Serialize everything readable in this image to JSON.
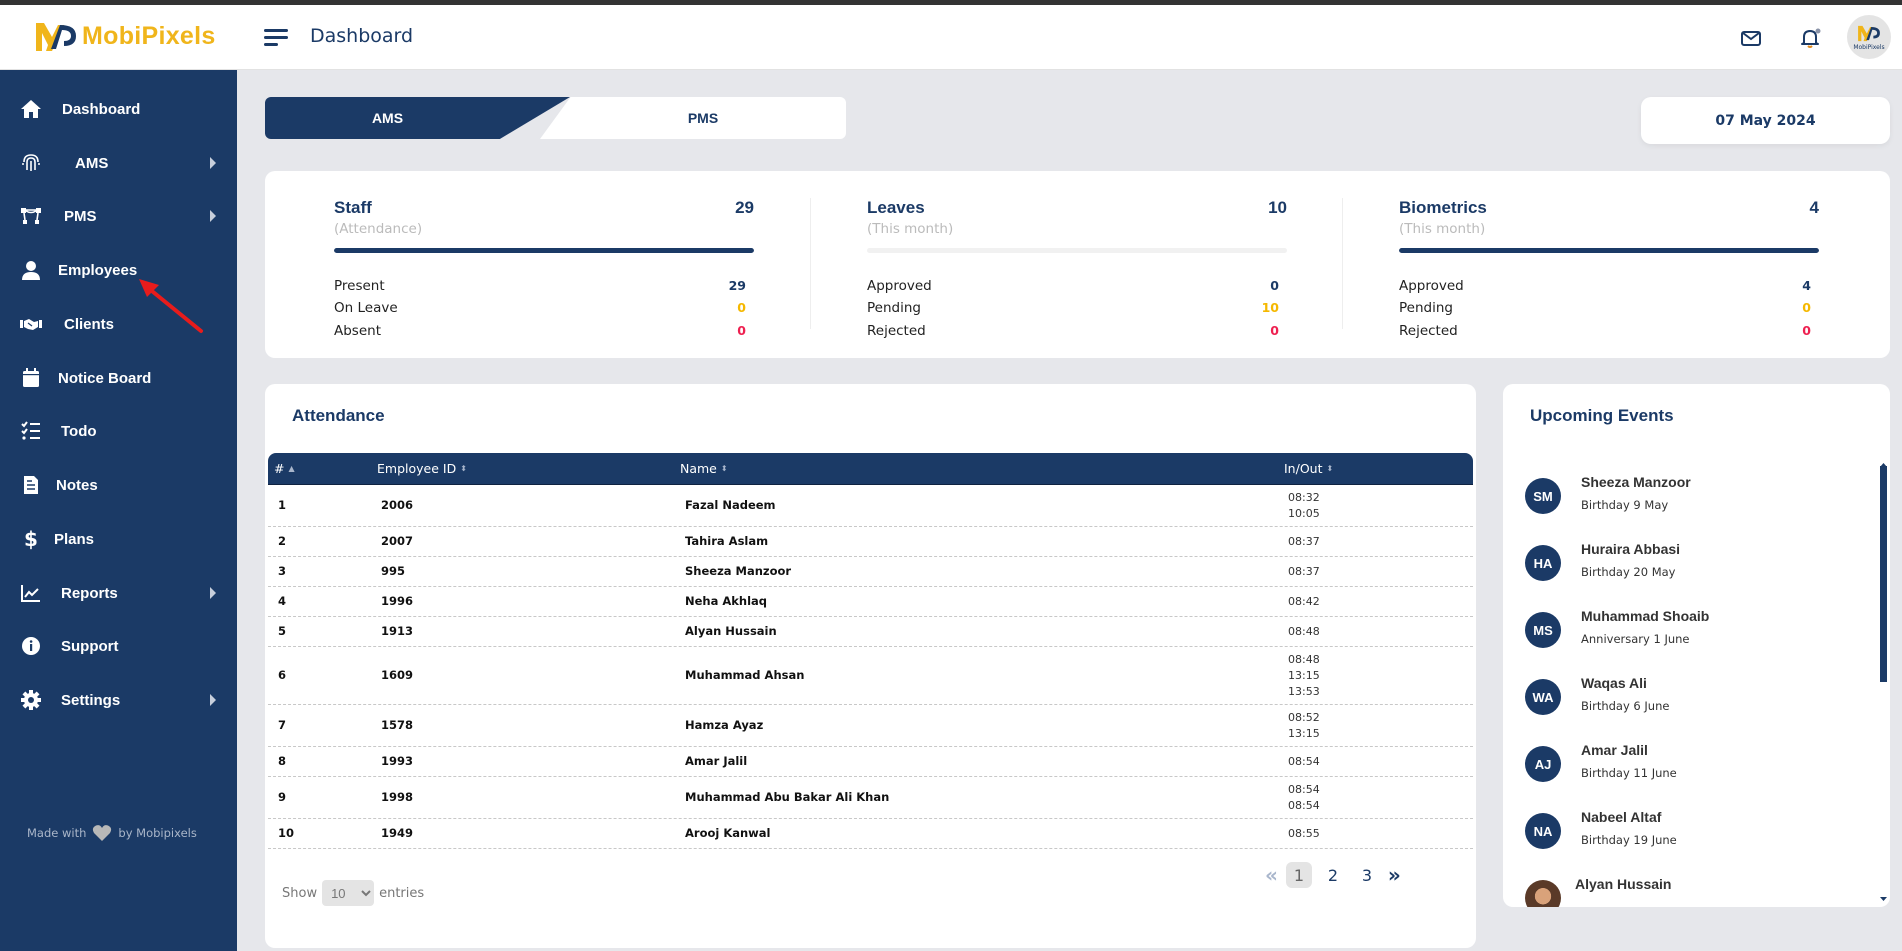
{
  "app": {
    "brand": "MobiPixels",
    "avatar_label": "MobiPixels"
  },
  "header": {
    "title": "Dashboard",
    "icons": [
      "menu-icon",
      "mail-icon",
      "bell-icon",
      "avatar"
    ],
    "notification_dot_color": "#8a93a8"
  },
  "colors": {
    "primary": "#1b3a66",
    "accent": "#f0b51b",
    "pending": "#f5b800",
    "danger": "#ee2050",
    "background": "#e6e7eb"
  },
  "sidebar": {
    "items": [
      {
        "label": "Dashboard",
        "icon": "home-icon",
        "has_submenu": false
      },
      {
        "label": "AMS",
        "icon": "fingerprint-icon",
        "has_submenu": true
      },
      {
        "label": "PMS",
        "icon": "vector-nodes-icon",
        "has_submenu": true
      },
      {
        "label": "Employees",
        "icon": "user-icon",
        "has_submenu": false
      },
      {
        "label": "Clients",
        "icon": "handshake-icon",
        "has_submenu": false
      },
      {
        "label": "Notice Board",
        "icon": "calendar-icon",
        "has_submenu": false
      },
      {
        "label": "Todo",
        "icon": "checklist-icon",
        "has_submenu": false
      },
      {
        "label": "Notes",
        "icon": "document-icon",
        "has_submenu": false
      },
      {
        "label": "Plans",
        "icon": "dollar-icon",
        "has_submenu": false
      },
      {
        "label": "Reports",
        "icon": "line-chart-icon",
        "has_submenu": true
      },
      {
        "label": "Support",
        "icon": "info-icon",
        "has_submenu": false
      },
      {
        "label": "Settings",
        "icon": "gear-icon",
        "has_submenu": true
      }
    ],
    "footer": {
      "prefix": "Made with",
      "suffix": "by Mobipixels"
    }
  },
  "tabs": {
    "ams": "AMS",
    "pms": "PMS",
    "active": "AMS"
  },
  "date": "07 May 2024",
  "stats": [
    {
      "title": "Staff",
      "subtitle": "(Attendance)",
      "total": "29",
      "progress": 1.0,
      "rows": [
        {
          "label": "Present",
          "value": "29",
          "status": "primary"
        },
        {
          "label": "On Leave",
          "value": "0",
          "status": "pending"
        },
        {
          "label": "Absent",
          "value": "0",
          "status": "danger"
        }
      ]
    },
    {
      "title": "Leaves",
      "subtitle": "(This month)",
      "total": "10",
      "progress": 0.0,
      "rows": [
        {
          "label": "Approved",
          "value": "0",
          "status": "primary"
        },
        {
          "label": "Pending",
          "value": "10",
          "status": "pending"
        },
        {
          "label": "Rejected",
          "value": "0",
          "status": "danger"
        }
      ]
    },
    {
      "title": "Biometrics",
      "subtitle": "(This month)",
      "total": "4",
      "progress": 1.0,
      "rows": [
        {
          "label": "Approved",
          "value": "4",
          "status": "primary"
        },
        {
          "label": "Pending",
          "value": "0",
          "status": "pending"
        },
        {
          "label": "Rejected",
          "value": "0",
          "status": "danger"
        }
      ]
    }
  ],
  "attendance": {
    "title": "Attendance",
    "columns": [
      "#",
      "Employee ID",
      "Name",
      "In/Out"
    ],
    "rows": [
      {
        "n": "1",
        "id": "2006",
        "name": "Fazal Nadeem",
        "times": [
          "08:32",
          "10:05"
        ]
      },
      {
        "n": "2",
        "id": "2007",
        "name": "Tahira Aslam",
        "times": [
          "08:37"
        ]
      },
      {
        "n": "3",
        "id": "995",
        "name": "Sheeza Manzoor",
        "times": [
          "08:37"
        ]
      },
      {
        "n": "4",
        "id": "1996",
        "name": "Neha Akhlaq",
        "times": [
          "08:42"
        ]
      },
      {
        "n": "5",
        "id": "1913",
        "name": "Alyan Hussain",
        "times": [
          "08:48"
        ]
      },
      {
        "n": "6",
        "id": "1609",
        "name": "Muhammad Ahsan",
        "times": [
          "08:48",
          "13:15",
          "13:53"
        ]
      },
      {
        "n": "7",
        "id": "1578",
        "name": "Hamza Ayaz",
        "times": [
          "08:52",
          "13:15"
        ]
      },
      {
        "n": "8",
        "id": "1993",
        "name": "Amar Jalil",
        "times": [
          "08:54"
        ]
      },
      {
        "n": "9",
        "id": "1998",
        "name": "Muhammad Abu Bakar Ali Khan",
        "times": [
          "08:54",
          "08:54"
        ]
      },
      {
        "n": "10",
        "id": "1949",
        "name": "Arooj Kanwal",
        "times": [
          "08:55"
        ]
      }
    ],
    "show_label": "Show",
    "entries_label": "entries",
    "page_size": "10",
    "pages": [
      "1",
      "2",
      "3"
    ],
    "current_page": "1",
    "prev_label": "«",
    "next_label": "»"
  },
  "events": {
    "title": "Upcoming Events",
    "items": [
      {
        "initials": "SM",
        "name": "Sheeza Manzoor",
        "detail": "Birthday 9 May"
      },
      {
        "initials": "HA",
        "name": "Huraira Abbasi",
        "detail": "Birthday 20 May"
      },
      {
        "initials": "MS",
        "name": "Muhammad Shoaib",
        "detail": "Anniversary 1 June"
      },
      {
        "initials": "WA",
        "name": "Waqas Ali",
        "detail": "Birthday 6 June"
      },
      {
        "initials": "AJ",
        "name": "Amar Jalil",
        "detail": "Birthday 11 June"
      },
      {
        "initials": "NA",
        "name": "Nabeel Altaf",
        "detail": "Birthday 19 June"
      },
      {
        "initials": "",
        "name": "Alyan Hussain",
        "detail": "",
        "photo": true
      }
    ]
  }
}
